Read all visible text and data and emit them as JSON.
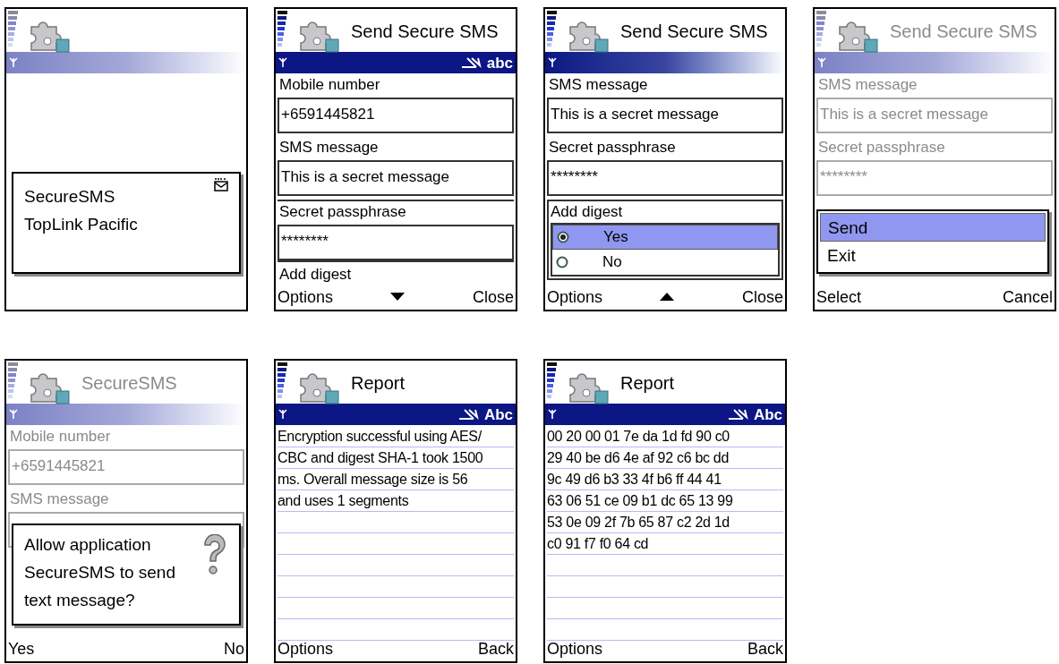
{
  "screens": [
    {
      "dimmed": true,
      "solid_bar": false,
      "dialog": {
        "kind": "note",
        "lines": [
          "SecureSMS",
          "TopLink Pacific"
        ]
      }
    },
    {
      "dimmed": false,
      "title": "Send Secure SMS",
      "solid_bar": true,
      "indicator": "abc",
      "body": [
        {
          "kind": "field",
          "label": "Mobile number",
          "value": "+6591445821",
          "focused": false
        },
        {
          "kind": "field",
          "label": "SMS message",
          "value": "This is a secret message",
          "focused": false
        },
        {
          "kind": "field",
          "label": "Secret passphrase",
          "value": "********",
          "focused": true
        },
        {
          "kind": "label",
          "label": "Add digest"
        }
      ],
      "softkeys": {
        "left": "Options",
        "scroll_up": false,
        "right": "Close"
      }
    },
    {
      "dimmed": false,
      "title": "Send Secure SMS",
      "solid_bar": false,
      "body": [
        {
          "kind": "field",
          "label": "SMS message",
          "value": "This is a secret message",
          "focused": false
        },
        {
          "kind": "field",
          "label": "Secret passphrase",
          "value": "********",
          "focused": false
        },
        {
          "kind": "radio",
          "label": "Add digest",
          "focused": true,
          "options": [
            {
              "label": "Yes",
              "selected": true
            },
            {
              "label": "No",
              "selected": false
            }
          ]
        }
      ],
      "softkeys": {
        "left": "Options",
        "scroll_up": true,
        "right": "Close"
      }
    },
    {
      "dimmed": true,
      "title": "Send Secure SMS",
      "solid_bar": false,
      "body": [
        {
          "kind": "field",
          "label": "SMS message",
          "value": "This is a secret message",
          "focused": false
        },
        {
          "kind": "field",
          "label": "Secret passphrase",
          "value": "********",
          "focused": false
        }
      ],
      "menu": [
        {
          "label": "Send",
          "selected": true
        },
        {
          "label": "Exit",
          "selected": false
        }
      ],
      "softkeys": {
        "left": "Select",
        "right": "Cancel"
      }
    },
    {
      "dimmed": true,
      "title": "SecureSMS",
      "solid_bar": false,
      "body": [
        {
          "kind": "field",
          "label": "Mobile number",
          "value": "+6591445821",
          "focused": false
        },
        {
          "kind": "field",
          "label": "SMS message",
          "focused": false
        }
      ],
      "dialog": {
        "kind": "query",
        "text": "Allow application SecureSMS to send text message?"
      },
      "softkeys": {
        "left": "Yes",
        "right": "No"
      }
    },
    {
      "dimmed": false,
      "title": "Report",
      "solid_bar": true,
      "indicator": "Abc",
      "body": [
        {
          "kind": "report",
          "lines": [
            "Encryption successful using AES/",
            "CBC and digest SHA-1 took 1500",
            "ms. Overall message size is 56",
            "and uses 1 segments"
          ]
        }
      ],
      "softkeys": {
        "left": "Options",
        "right": "Back"
      }
    },
    {
      "dimmed": false,
      "title": "Report",
      "solid_bar": true,
      "indicator": "Abc",
      "body": [
        {
          "kind": "report",
          "lines": [
            "00 20 00 01 7e da 1d fd 90 c0",
            "29 40 be d6 4e af 92 c6 bc dd",
            "9c 49 d6 b3 33 4f b6 ff 44 41",
            "63 06 51 ce 09 b1 dc 65 13 99",
            "53 0e 09 2f 7b 65 87 c2 2d 1d",
            "c0 91 f7 f0 64 cd"
          ]
        }
      ],
      "softkeys": {
        "left": "Options",
        "right": "Back"
      }
    }
  ]
}
